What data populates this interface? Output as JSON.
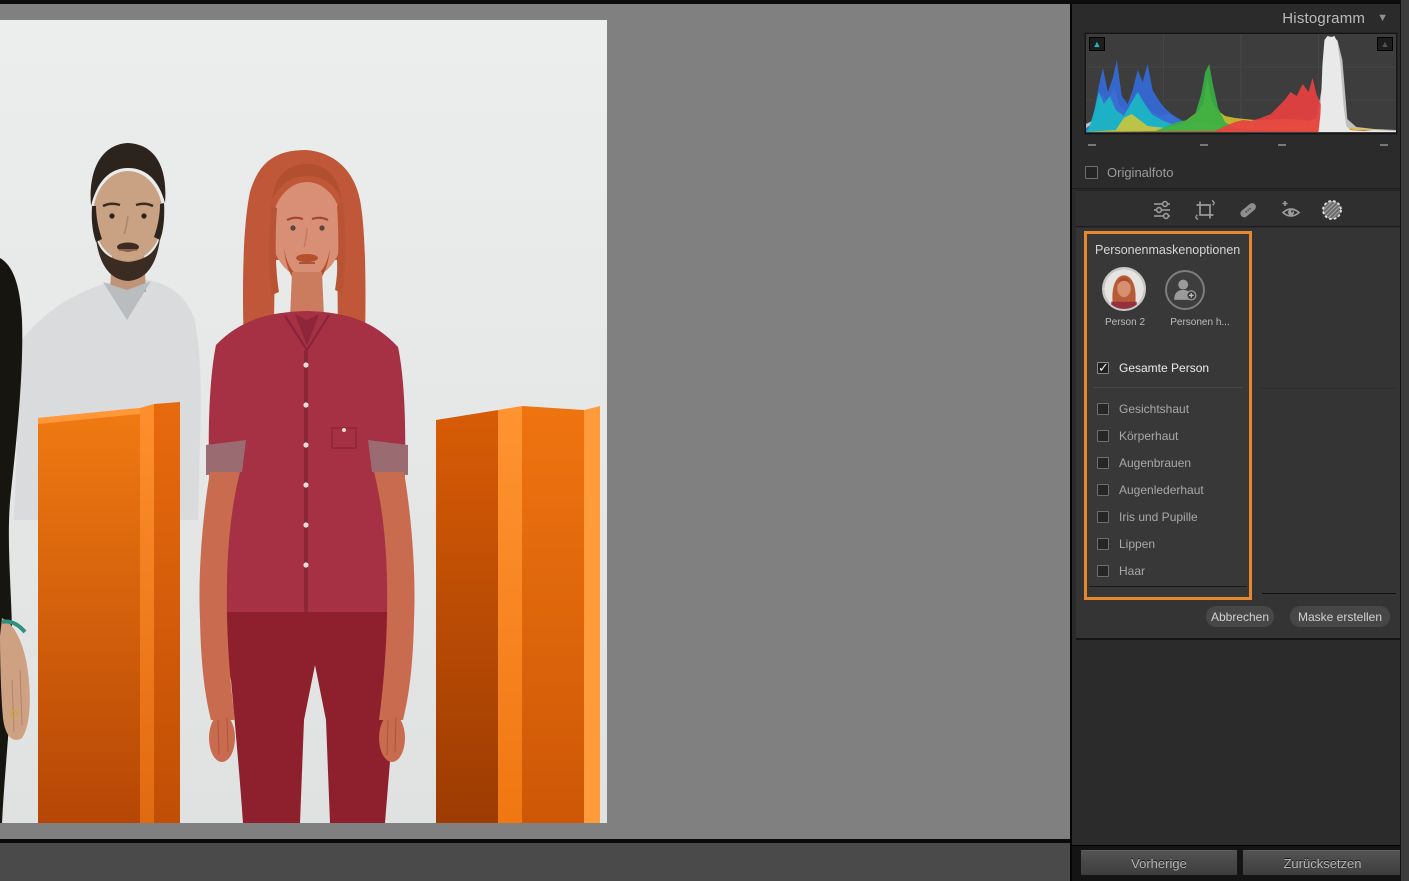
{
  "histogram": {
    "title": "Histogramm",
    "collapse_glyph": "▼",
    "original_label": "Originalfoto",
    "clipping_indicators": [
      "shadow-clipping-indicator",
      "highlight-clipping-indicator"
    ]
  },
  "tools": {
    "icons": [
      "edit-sliders-icon",
      "crop-icon",
      "healing-icon",
      "red-eye-icon",
      "masking-icon"
    ],
    "active_tool": "masking-icon"
  },
  "mask": {
    "title": "Personenmaskenoptionen",
    "persons": [
      {
        "label": "Person 2",
        "selected": true
      },
      {
        "label": "Personen h...",
        "selected": false
      }
    ],
    "options": [
      {
        "label": "Gesamte Person",
        "checked": true
      },
      {
        "label": "Gesichtshaut",
        "checked": false
      },
      {
        "label": "Körperhaut",
        "checked": false
      },
      {
        "label": "Augenbrauen",
        "checked": false
      },
      {
        "label": "Augenlederhaut",
        "checked": false
      },
      {
        "label": "Iris und Pupille",
        "checked": false
      },
      {
        "label": "Lippen",
        "checked": false
      },
      {
        "label": "Haar",
        "checked": false
      }
    ],
    "cancel_label": "Abbrechen",
    "create_label": "Maske erstellen"
  },
  "footer": {
    "previous_label": "Vorherige",
    "reset_label": "Zurücksetzen"
  },
  "colors": {
    "accent_orange_border": "#e8872b",
    "panel_background": "#2b2b2b",
    "canvas_background": "#808080",
    "mask_overlay_red": "#c23a3a",
    "shadow_clipping_triangle": "#17b8be"
  }
}
